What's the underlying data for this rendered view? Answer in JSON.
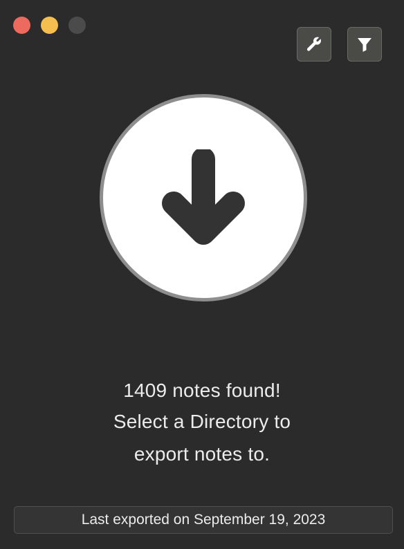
{
  "window": {
    "controls": [
      "close",
      "minimize",
      "zoom"
    ]
  },
  "toolbar": {
    "settings_icon": "wrench-icon",
    "filter_icon": "filter-icon"
  },
  "drop_target": {
    "icon": "arrow-down-icon"
  },
  "message": {
    "line1": "1409 notes found!",
    "line2": "Select a Directory to",
    "line3": "export notes to."
  },
  "status": {
    "last_exported": "Last exported on September 19, 2023"
  },
  "colors": {
    "background": "#2b2b2b",
    "close": "#ec6a5e",
    "minimize": "#f4bf4f",
    "zoom_inactive": "#4b4b4b",
    "circle_fill": "#ffffff",
    "circle_border": "#8e8e8e"
  }
}
